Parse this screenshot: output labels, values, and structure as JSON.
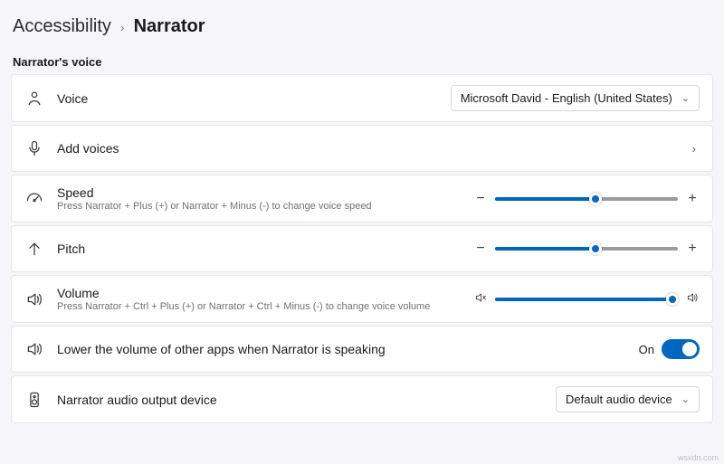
{
  "breadcrumb": {
    "parent": "Accessibility",
    "current": "Narrator"
  },
  "section_title": "Narrator's voice",
  "voice": {
    "label": "Voice",
    "selected": "Microsoft David - English (United States)"
  },
  "add_voices": {
    "label": "Add voices"
  },
  "speed": {
    "label": "Speed",
    "hint": "Press Narrator + Plus (+) or Narrator + Minus (-) to change voice speed",
    "value_pct": 55
  },
  "pitch": {
    "label": "Pitch",
    "value_pct": 55
  },
  "volume": {
    "label": "Volume",
    "hint": "Press Narrator + Ctrl + Plus (+) or Narrator + Ctrl + Minus (-) to change voice volume",
    "value_pct": 97
  },
  "lower_volume": {
    "label": "Lower the volume of other apps when Narrator is speaking",
    "state_label": "On",
    "on": true
  },
  "output_device": {
    "label": "Narrator audio output device",
    "selected": "Default audio device"
  },
  "watermark": "wsxdn.com"
}
